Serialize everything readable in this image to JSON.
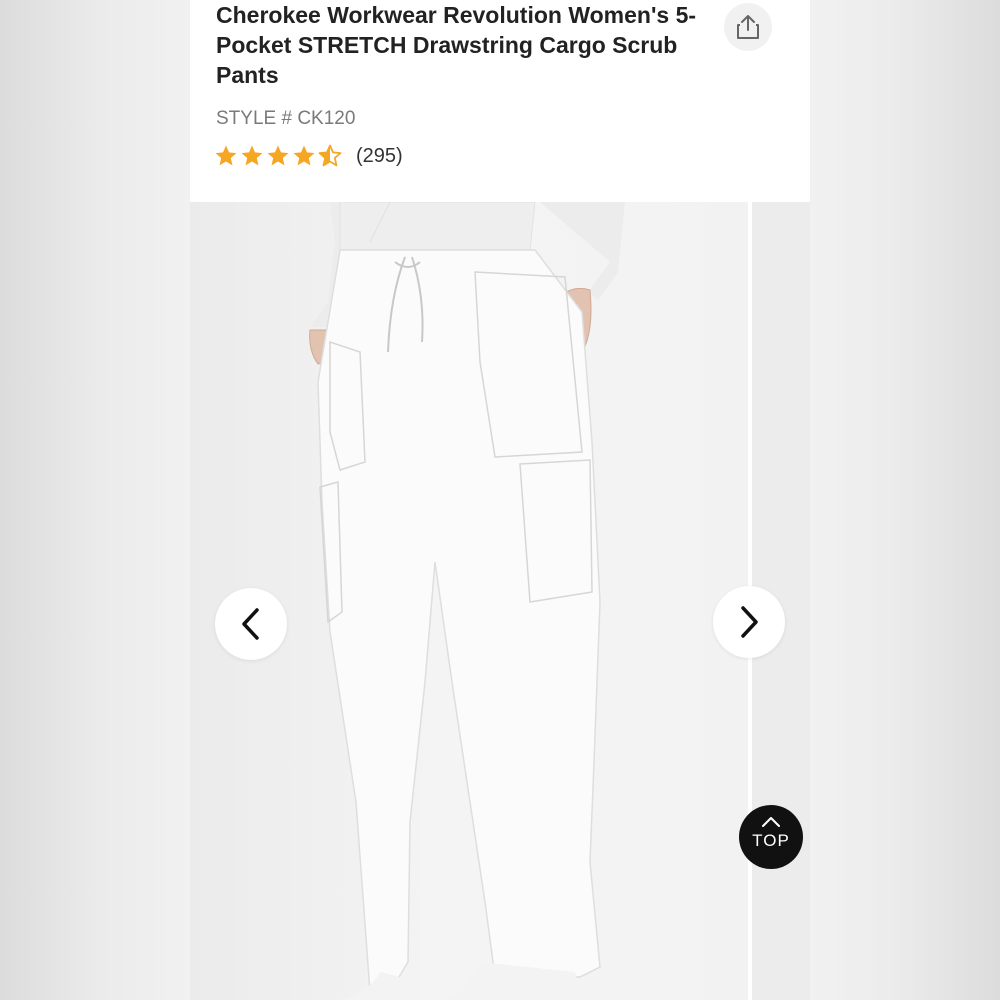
{
  "product": {
    "title": "Cherokee Workwear Revolution Women's 5-Pocket STRETCH Drawstring Cargo Scrub Pants",
    "style_line": "STYLE # CK120",
    "rating": 4.5,
    "review_count": "(295)"
  },
  "gallery": {
    "prev_icon": "chevron-left-icon",
    "next_icon": "chevron-right-icon"
  },
  "actions": {
    "share_icon": "share-icon",
    "top_label": "TOP",
    "top_icon": "chevron-up-icon"
  },
  "colors": {
    "star": "#f5a623",
    "title_text": "#222222",
    "top_button": "#111111"
  }
}
